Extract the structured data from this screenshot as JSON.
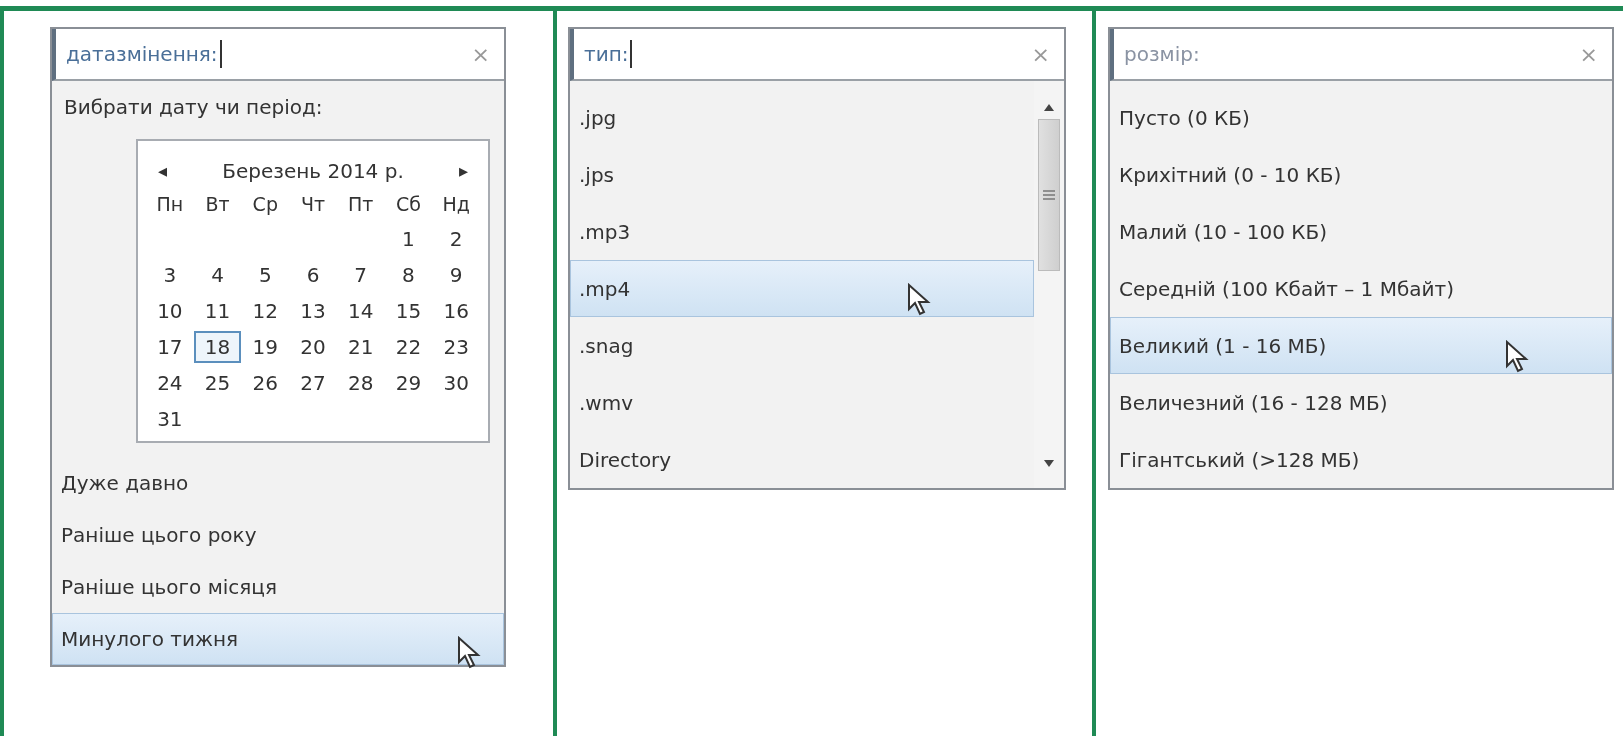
{
  "panels": [
    {
      "kind": "date",
      "search": {
        "value": "датазмінення:",
        "caret": true,
        "clear": "×"
      },
      "prompt": "Вибрати дату чи період:",
      "calendar": {
        "prev": "◂",
        "title": "Березень 2014 р.",
        "next": "▸",
        "weekdays": [
          "Пн",
          "Вт",
          "Ср",
          "Чт",
          "Пт",
          "Сб",
          "Нд"
        ],
        "weeks": [
          [
            {
              "label": "1",
              "selected": false
            },
            {
              "label": "2",
              "selected": false
            }
          ],
          [
            {
              "label": "3",
              "selected": false
            },
            {
              "label": "4",
              "selected": false
            },
            {
              "label": "5",
              "selected": false
            },
            {
              "label": "6",
              "selected": false
            },
            {
              "label": "7",
              "selected": false
            },
            {
              "label": "8",
              "selected": false
            },
            {
              "label": "9",
              "selected": false
            }
          ],
          [
            {
              "label": "10",
              "selected": false
            },
            {
              "label": "11",
              "selected": false
            },
            {
              "label": "12",
              "selected": false
            },
            {
              "label": "13",
              "selected": false
            },
            {
              "label": "14",
              "selected": false
            },
            {
              "label": "15",
              "selected": false
            },
            {
              "label": "16",
              "selected": false
            }
          ],
          [
            {
              "label": "17",
              "selected": false
            },
            {
              "label": "18",
              "selected": true
            },
            {
              "label": "19",
              "selected": false
            },
            {
              "label": "20",
              "selected": false
            },
            {
              "label": "21",
              "selected": false
            },
            {
              "label": "22",
              "selected": false
            },
            {
              "label": "23",
              "selected": false
            }
          ],
          [
            {
              "label": "24",
              "selected": false
            },
            {
              "label": "25",
              "selected": false
            },
            {
              "label": "26",
              "selected": false
            },
            {
              "label": "27",
              "selected": false
            },
            {
              "label": "28",
              "selected": false
            },
            {
              "label": "29",
              "selected": false
            },
            {
              "label": "30",
              "selected": false
            }
          ],
          [
            {
              "label": "31",
              "selected": false
            }
          ]
        ]
      },
      "items": [
        {
          "label": "Дуже давно",
          "selected": false
        },
        {
          "label": "Раніше цього року",
          "selected": false
        },
        {
          "label": "Раніше цього місяця",
          "selected": false
        },
        {
          "label": "Минулого тижня",
          "selected": true
        }
      ]
    },
    {
      "kind": "list",
      "search": {
        "value": "тип:",
        "caret": true,
        "clear": "×"
      },
      "scrollbar": true,
      "items": [
        {
          "label": ".jpg",
          "selected": false
        },
        {
          "label": ".jps",
          "selected": false
        },
        {
          "label": ".mp3",
          "selected": false
        },
        {
          "label": ".mp4",
          "selected": true
        },
        {
          "label": ".snag",
          "selected": false
        },
        {
          "label": ".wmv",
          "selected": false
        },
        {
          "label": "Directory",
          "selected": false
        }
      ]
    },
    {
      "kind": "list",
      "search": {
        "value": "розмір:",
        "caret": false,
        "clear": "×"
      },
      "scrollbar": false,
      "items": [
        {
          "label": "Пусто (0 КБ)",
          "selected": false
        },
        {
          "label": "Крихітний (0 - 10 КБ)",
          "selected": false
        },
        {
          "label": "Малий (10 - 100 КБ)",
          "selected": false
        },
        {
          "label": "Середній (100 Кбайт – 1 Мбайт)",
          "selected": false
        },
        {
          "label": "Великий (1 - 16 МБ)",
          "selected": true
        },
        {
          "label": "Величезний (16 - 128 МБ)",
          "selected": false
        },
        {
          "label": "Гігантський (>128 МБ)",
          "selected": false
        }
      ]
    }
  ]
}
